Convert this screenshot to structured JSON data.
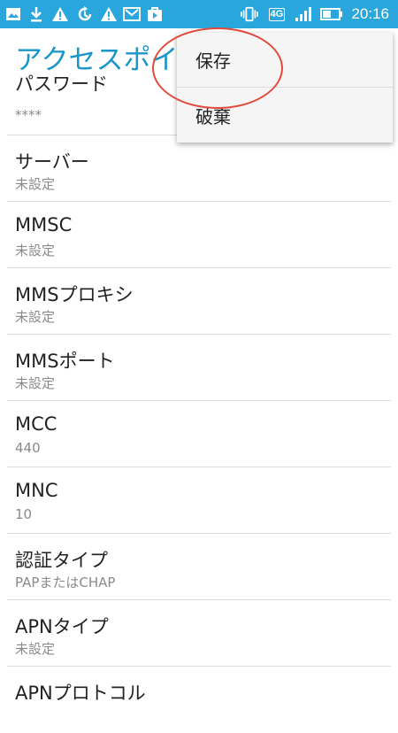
{
  "status_bar": {
    "time": "20:16",
    "network": "4G",
    "bg_color": "#29a6dc",
    "left_icons": [
      "image-icon",
      "download-icon",
      "warning-icon",
      "sync-icon",
      "warning-icon",
      "gmail-icon",
      "play-store-icon"
    ],
    "right_icons": [
      "vibrate-icon",
      "network-4g-icon",
      "signal-icon",
      "battery-icon"
    ]
  },
  "app": {
    "title": "アクセスポイ",
    "title_color": "#1a96c8"
  },
  "preferences": [
    {
      "title": "パスワード",
      "summary": "****"
    },
    {
      "title": "サーバー",
      "summary": "未設定"
    },
    {
      "title": "MMSC",
      "summary": "未設定"
    },
    {
      "title": "MMSプロキシ",
      "summary": "未設定"
    },
    {
      "title": "MMSポート",
      "summary": "未設定"
    },
    {
      "title": "MCC",
      "summary": "440"
    },
    {
      "title": "MNC",
      "summary": "10"
    },
    {
      "title": "認証タイプ",
      "summary": "PAPまたはCHAP"
    },
    {
      "title": "APNタイプ",
      "summary": "未設定"
    },
    {
      "title": "APNプロトコル",
      "summary": ""
    }
  ],
  "menu": {
    "save_label": "保存",
    "discard_label": "破棄"
  },
  "annotation_color": "#e14a3b"
}
